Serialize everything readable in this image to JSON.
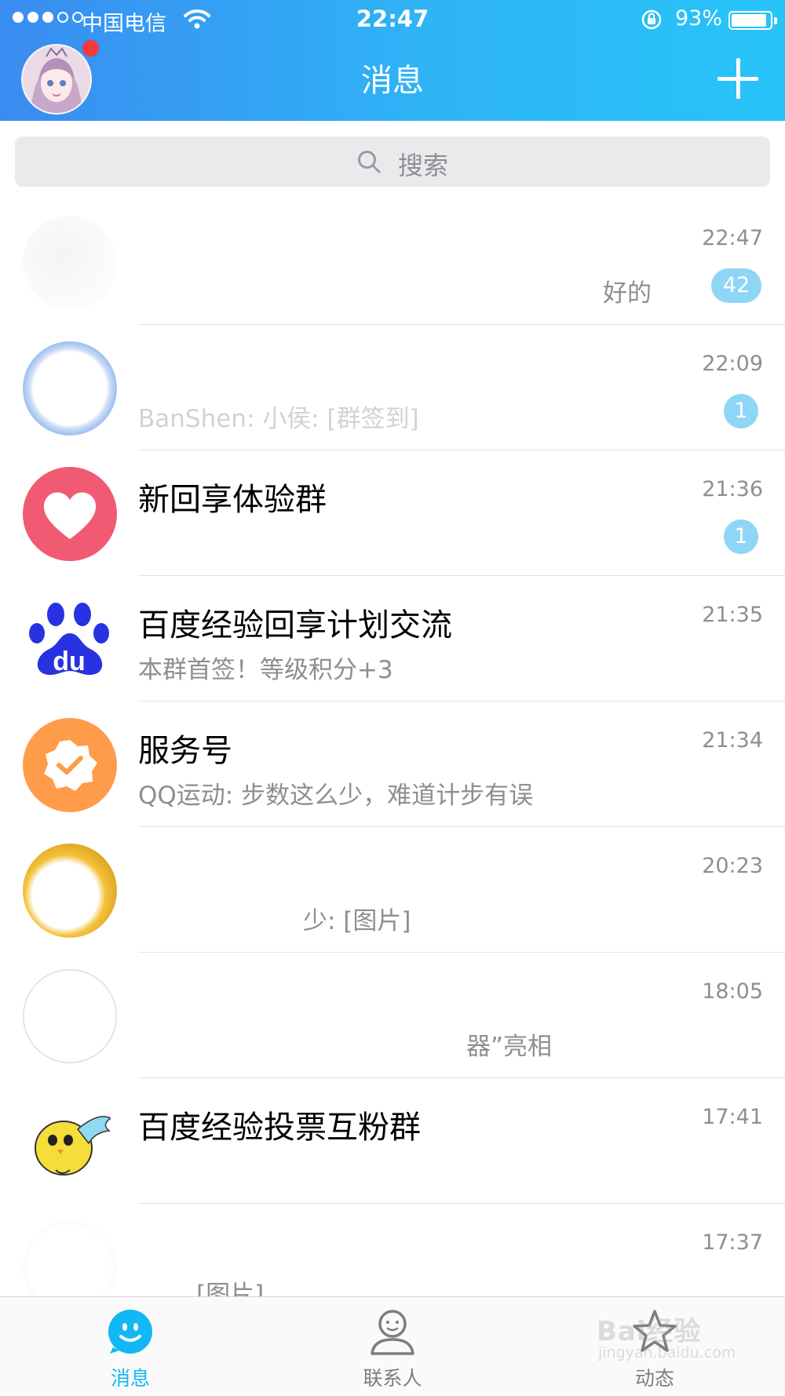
{
  "status_bar": {
    "carrier": "中国电信",
    "time": "22:47",
    "battery": "93%"
  },
  "header": {
    "title": "消息",
    "avatar_icon": "user-avatar-anime-girl",
    "add_icon": "plus-icon"
  },
  "search": {
    "placeholder": "搜索"
  },
  "conversations": [
    {
      "name": "",
      "time": "22:47",
      "preview": "好的",
      "unread": "42",
      "avatar": "blurred-avatar"
    },
    {
      "name": "",
      "time": "22:09",
      "preview": "BanShen: 小侯: [群签到]",
      "unread": "1",
      "avatar": "blurred-avatar"
    },
    {
      "name": "新回享体验群",
      "time": "21:36",
      "preview": "",
      "unread": "1",
      "avatar": "heart-icon"
    },
    {
      "name": "百度经验回享计划交流",
      "time": "21:35",
      "preview": "本群首签！等级积分+3",
      "unread": "",
      "avatar": "baidu-paw-icon"
    },
    {
      "name": "服务号",
      "time": "21:34",
      "preview": "QQ运动: 步数这么少，难道计步有误",
      "unread": "",
      "avatar": "verified-badge-icon"
    },
    {
      "name": "",
      "time": "20:23",
      "preview": "少: [图片]",
      "unread": "",
      "avatar": "blurred-avatar"
    },
    {
      "name": "",
      "time": "18:05",
      "preview": "器”亮相",
      "unread": "",
      "avatar": "blurred-avatar"
    },
    {
      "name": "百度经验投票互粉群",
      "time": "17:41",
      "preview": "",
      "unread": "",
      "avatar": "yellow-chick-icon"
    },
    {
      "name": "",
      "time": "17:37",
      "preview": "[图片]",
      "unread": "",
      "avatar": "blurred-avatar"
    }
  ],
  "tabbar": {
    "tabs": [
      {
        "label": "消息",
        "icon": "chat-smile-icon",
        "active": true
      },
      {
        "label": "联系人",
        "icon": "person-icon",
        "active": false
      },
      {
        "label": "动态",
        "icon": "star-icon",
        "active": false
      }
    ]
  },
  "watermark": {
    "text": "Bai经验",
    "sub": "jingyan.baidu.com"
  },
  "colors": {
    "accent": "#12b7f5",
    "header_gradient_start": "#3a8cf0",
    "header_gradient_end": "#27c4f8",
    "unread_badge": "#8ed6f5",
    "notification_dot": "#f43a3a"
  }
}
